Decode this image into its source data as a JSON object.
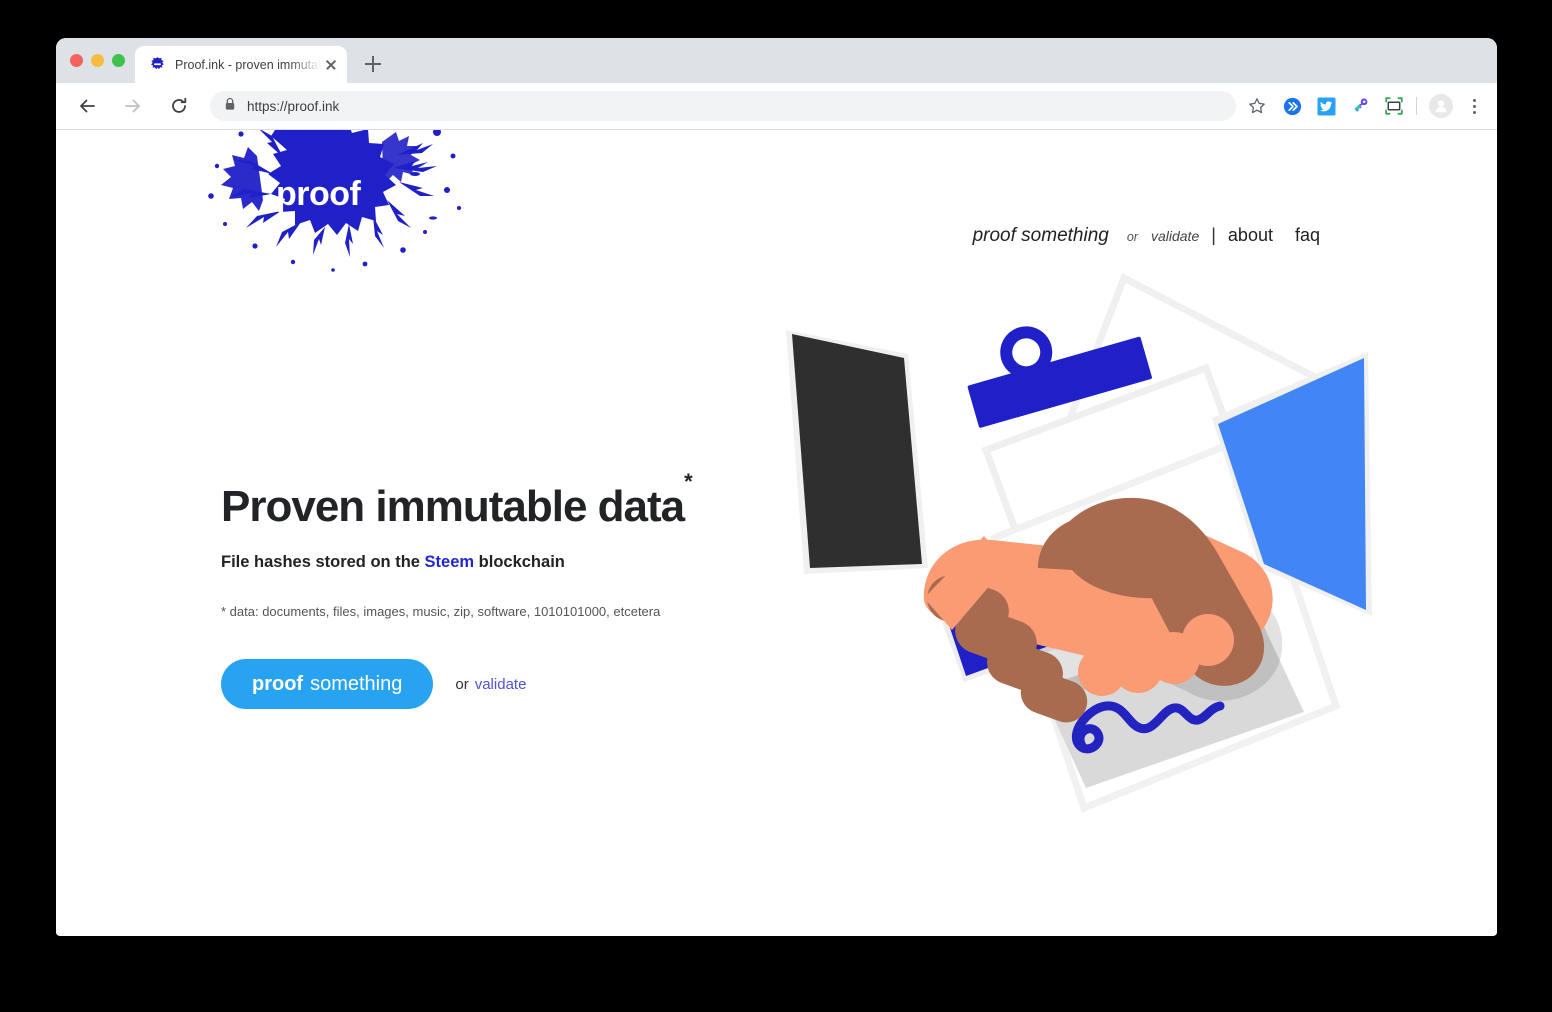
{
  "browser": {
    "traffic_lights": [
      "close",
      "minimize",
      "maximize"
    ],
    "tab": {
      "title": "Proof.ink - proven immutable fi",
      "favicon": "proof-splat-favicon",
      "close_label": "×"
    },
    "new_tab_label": "+",
    "nav": {
      "back": "back-arrow",
      "forward": "forward-arrow",
      "reload": "reload-arrow"
    },
    "omnibox": {
      "url": "https://proof.ink",
      "lock": "secure-lock-icon",
      "star": "bookmark-star-icon"
    },
    "extensions": [
      {
        "name": "chevrons-extension-icon",
        "color": "#1a73e8"
      },
      {
        "name": "twitter-extension-icon",
        "color": "#27a3f2"
      },
      {
        "name": "key-extension-icon",
        "color": "#2bc4b8"
      },
      {
        "name": "screenshot-extension-icon",
        "color": "#34a853"
      }
    ],
    "avatar": "profile-avatar",
    "menu": "three-dot-menu"
  },
  "site": {
    "logo": {
      "text": "proof",
      "splat_color": "#2020c8"
    },
    "nav": {
      "proof_something": "proof something",
      "or": "or",
      "validate": "validate",
      "separator": "|",
      "about": "about",
      "faq": "faq"
    },
    "hero": {
      "headline": "Proven immutable data",
      "headline_asterisk": "*",
      "subhead_before": "File hashes stored on the ",
      "subhead_link": "Steem",
      "subhead_after": " blockchain",
      "footnote": "* data: documents, files, images, music, zip, software, 1010101000, etcetera",
      "cta_bold": "proof",
      "cta_regular": "something",
      "cta_or": "or",
      "cta_validate": "validate"
    },
    "illustration": {
      "name": "handshake-over-contract-illustration",
      "colors": {
        "dark_sleeve": "#2f2f2f",
        "blue_sleeve": "#4285f4",
        "clip": "#2020c8",
        "stamp": "#2020c8",
        "signature": "#2323c0",
        "hand_light": "#fa9b74",
        "hand_dark": "#a96b4f",
        "paper": "#ffffff",
        "paper_edge": "#ededed",
        "signature_bar": "#d9d9d9"
      }
    }
  },
  "colors": {
    "accent_blue": "#27a3f2",
    "brand_blue": "#2020c8",
    "link_blue": "#4f52d8",
    "text_dark": "#222326",
    "tab_strip": "#dee1e6",
    "omnibox_bg": "#f1f3f4"
  }
}
